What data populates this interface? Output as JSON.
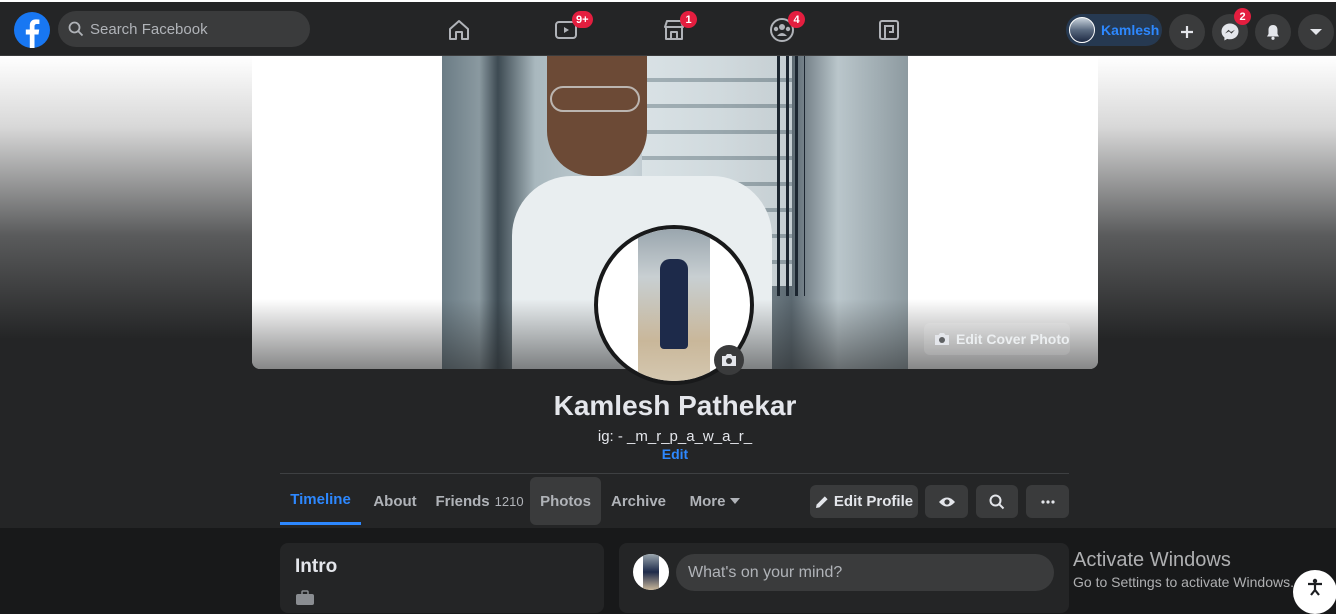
{
  "topbar": {
    "search_placeholder": "Search Facebook",
    "nav": [
      {
        "name": "home",
        "badge": ""
      },
      {
        "name": "watch",
        "badge": "9+"
      },
      {
        "name": "marketplace",
        "badge": "1"
      },
      {
        "name": "groups",
        "badge": "4"
      },
      {
        "name": "gaming",
        "badge": ""
      }
    ],
    "user_name": "Kamlesh",
    "messenger_badge": "2"
  },
  "cover": {
    "edit_label": "Edit Cover Photo"
  },
  "profile": {
    "name": "Kamlesh Pathekar",
    "bio": "ig: - _m_r_p_a_w_a_r_",
    "bio_edit": "Edit"
  },
  "tabs": [
    {
      "label": "Timeline",
      "count": ""
    },
    {
      "label": "About",
      "count": ""
    },
    {
      "label": "Friends",
      "count": "1210"
    },
    {
      "label": "Photos",
      "count": ""
    },
    {
      "label": "Archive",
      "count": ""
    },
    {
      "label": "More",
      "count": ""
    }
  ],
  "actions": {
    "edit_profile": "Edit Profile"
  },
  "intro": {
    "title": "Intro"
  },
  "composer": {
    "placeholder": "What's on your mind?"
  },
  "watermark": {
    "title": "Activate Windows",
    "subtitle": "Go to Settings to activate Windows."
  },
  "colors": {
    "accent": "#2d88ff",
    "brand": "#1877f2",
    "badge": "#e41e3f",
    "surface": "#242526",
    "background": "#18191a"
  }
}
